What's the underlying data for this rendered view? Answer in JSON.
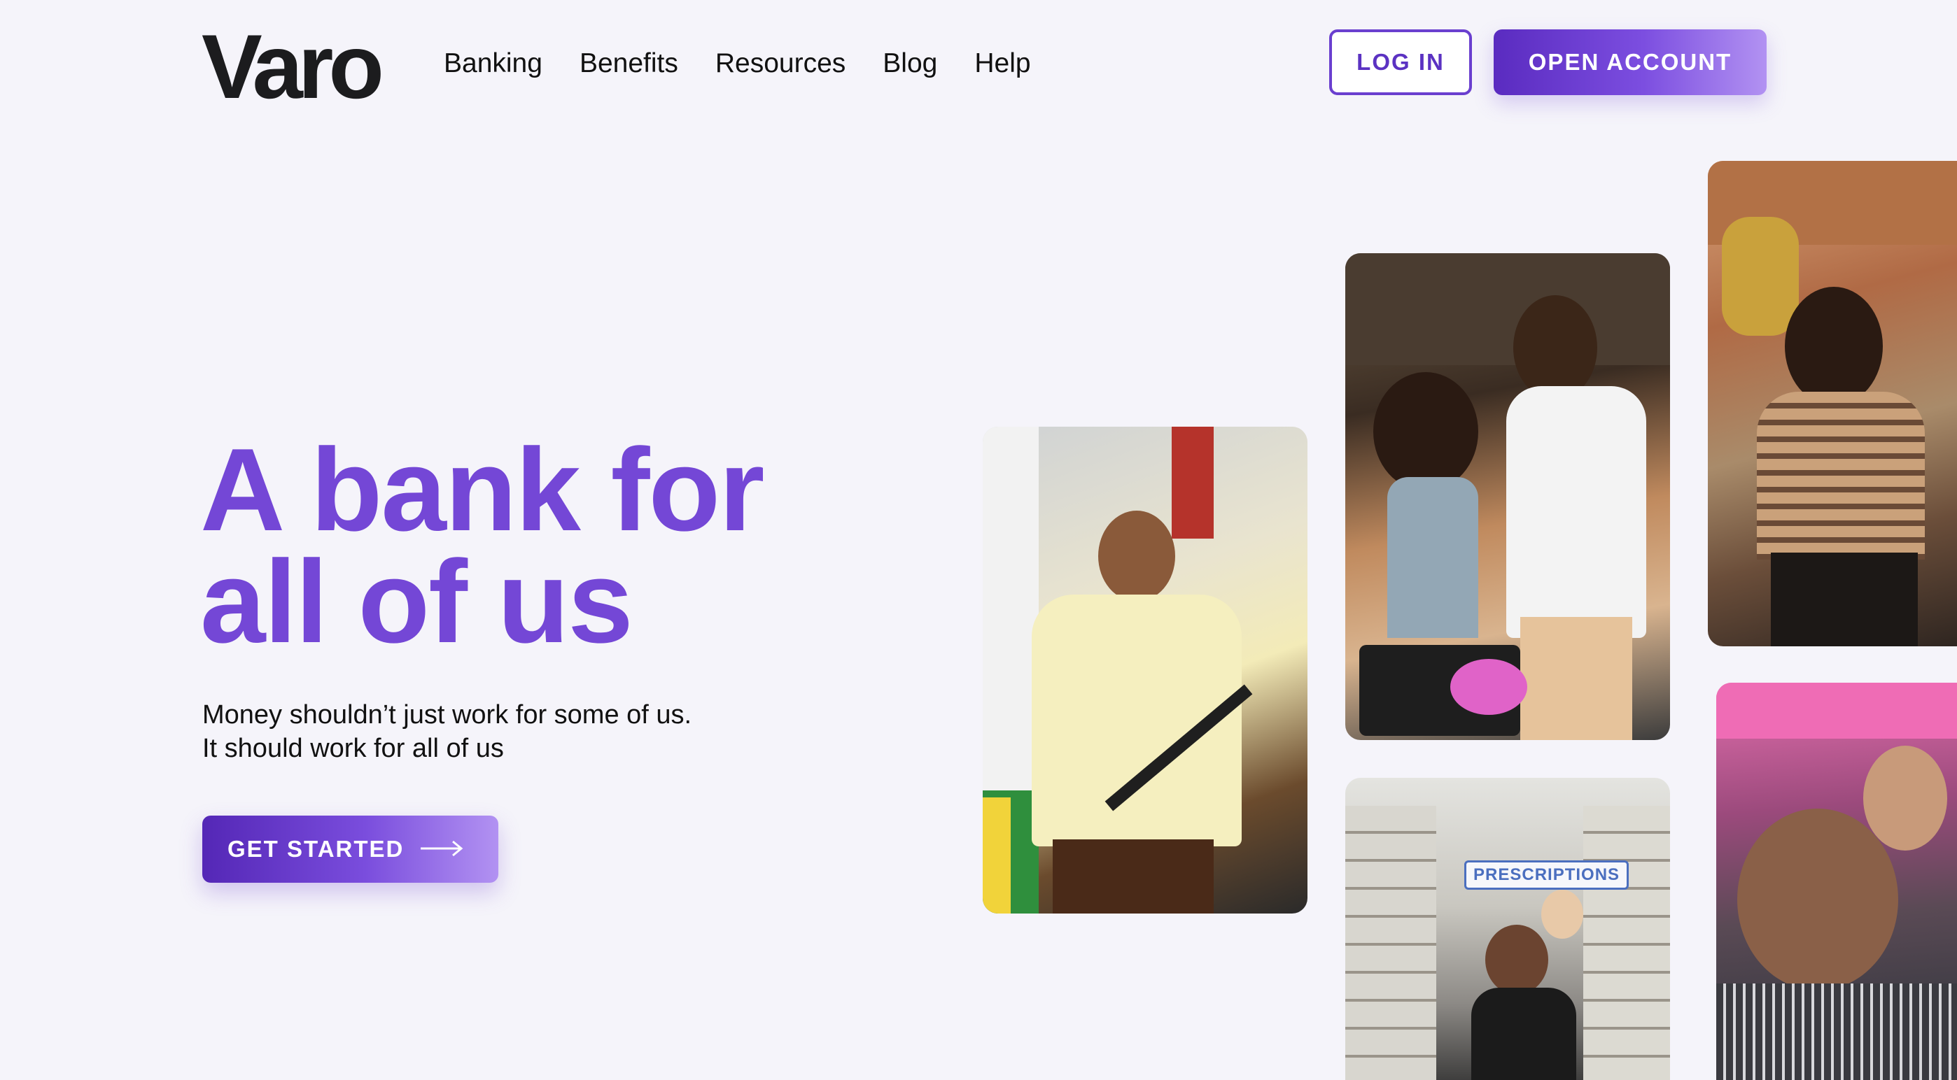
{
  "brand": {
    "logo_text": "Varo",
    "accent": "#7447d6"
  },
  "nav": {
    "items": [
      "Banking",
      "Benefits",
      "Resources",
      "Blog",
      "Help"
    ]
  },
  "header": {
    "login_label": "LOG IN",
    "open_account_label": "OPEN ACCOUNT"
  },
  "hero": {
    "title_line1": "A bank for",
    "title_line2": "all of us",
    "subtitle_line1": "Money shouldn’t just work for some of us.",
    "subtitle_line2": "It should work for all of us",
    "cta_label": "GET STARTED"
  },
  "photos": {
    "pharmacy_sign": "PRESCRIPTIONS"
  }
}
